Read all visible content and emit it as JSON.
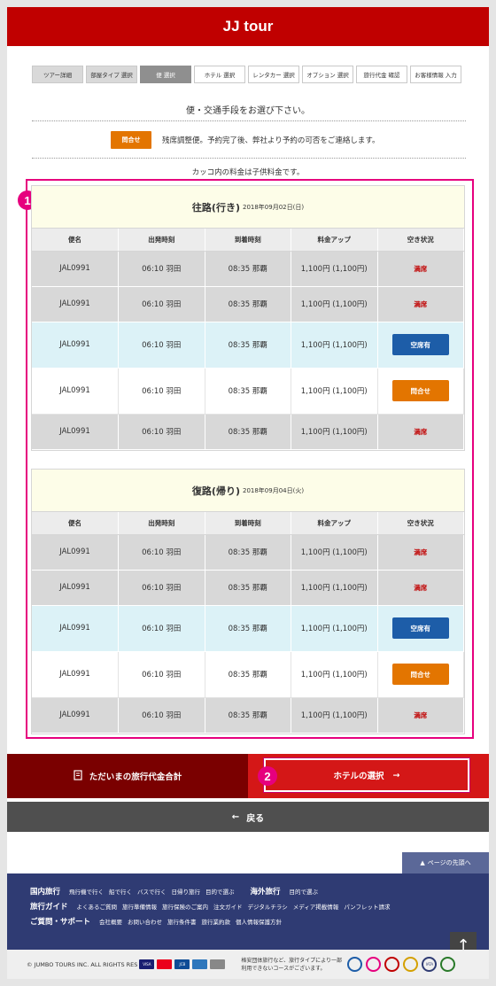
{
  "header": {
    "title": "JJ tour"
  },
  "steps": [
    {
      "label": "ツアー詳細",
      "state": "done"
    },
    {
      "label": "部屋タイプ 選択",
      "state": "done"
    },
    {
      "label": "便 選択",
      "state": "active"
    },
    {
      "label": "ホテル 選択",
      "state": "todo"
    },
    {
      "label": "レンタカー 選択",
      "state": "todo"
    },
    {
      "label": "オプション 選択",
      "state": "todo"
    },
    {
      "label": "旅行代金 確認",
      "state": "todo"
    },
    {
      "label": "お客様情報 入力",
      "state": "todo"
    }
  ],
  "lead": "便・交通手段をお選び下さい。",
  "notice": {
    "button": "問合せ",
    "text": "残席調整便。予約完了後、弊社より予約の可否をご連絡します。"
  },
  "child_note": "カッコ内の料金は子供料金です。",
  "badges": {
    "one": "1",
    "two": "2"
  },
  "columns": [
    "便名",
    "出発時刻",
    "到着時刻",
    "料金アップ",
    "空き状況"
  ],
  "outbound": {
    "direction": "往路(行き)",
    "date": "2018年09月02日(日)",
    "rows": [
      {
        "flight": "JAL0991",
        "dep": "06:10 羽田",
        "arr": "08:35 那覇",
        "price": "1,100円 (1,100円)",
        "status": "満席"
      },
      {
        "flight": "JAL0991",
        "dep": "06:10 羽田",
        "arr": "08:35 那覇",
        "price": "1,100円 (1,100円)",
        "status": "満席"
      },
      {
        "flight": "JAL0991",
        "dep": "06:10 羽田",
        "arr": "08:35 那覇",
        "price": "1,100円 (1,100円)",
        "status": "空席有"
      },
      {
        "flight": "JAL0991",
        "dep": "06:10 羽田",
        "arr": "08:35 那覇",
        "price": "1,100円 (1,100円)",
        "status": "問合せ"
      },
      {
        "flight": "JAL0991",
        "dep": "06:10 羽田",
        "arr": "08:35 那覇",
        "price": "1,100円 (1,100円)",
        "status": "満席"
      }
    ]
  },
  "inbound": {
    "direction": "復路(帰り)",
    "date": "2018年09月04日(火)",
    "rows": [
      {
        "flight": "JAL0991",
        "dep": "06:10 羽田",
        "arr": "08:35 那覇",
        "price": "1,100円 (1,100円)",
        "status": "満席"
      },
      {
        "flight": "JAL0991",
        "dep": "06:10 羽田",
        "arr": "08:35 那覇",
        "price": "1,100円 (1,100円)",
        "status": "満席"
      },
      {
        "flight": "JAL0991",
        "dep": "06:10 羽田",
        "arr": "08:35 那覇",
        "price": "1,100円 (1,100円)",
        "status": "空席有"
      },
      {
        "flight": "JAL0991",
        "dep": "06:10 羽田",
        "arr": "08:35 那覇",
        "price": "1,100円 (1,100円)",
        "status": "問合せ"
      },
      {
        "flight": "JAL0991",
        "dep": "06:10 羽田",
        "arr": "08:35 那覇",
        "price": "1,100円 (1,100円)",
        "status": "満席"
      }
    ]
  },
  "actions": {
    "total": "ただいまの旅行代金合計",
    "hotel": "ホテルの選択",
    "back": "戻る",
    "pagetop": "ページの先頭へ"
  },
  "footer": {
    "rows": [
      {
        "head": "国内旅行",
        "links": [
          "飛行機で行く",
          "船で行く",
          "バスで行く",
          "日帰り旅行",
          "目的で選ぶ"
        ],
        "head2": "海外旅行",
        "links2": [
          "目的で選ぶ"
        ]
      },
      {
        "head": "旅行ガイド",
        "links": [
          "よくあるご質問",
          "旅行準備情報",
          "旅行保険のご案内",
          "注文ガイド",
          "デジタルチラシ",
          "メディア掲載情報",
          "パンフレット請求"
        ]
      },
      {
        "head": "ご質問・サポート",
        "links": [
          "会社概要",
          "お問い合わせ",
          "旅行条件書",
          "旅行業約款",
          "個人情報保護方針"
        ]
      }
    ],
    "copyright": "© JUMBO TOURS INC. ALL RIGHTS RES",
    "card_brands": [
      "VISA",
      "",
      "JCB",
      "",
      ""
    ],
    "note": "格安団体旅行など、旅行タイプにより一部利用できないコースがございます。",
    "logo_texts": [
      "",
      "",
      "",
      "",
      "IATA",
      ""
    ]
  },
  "colors": {
    "brand_red": "#c00000",
    "highlight": "#e6007e",
    "available_blue": "#1d5da8",
    "inquiry_orange": "#e37500",
    "footer_navy": "#2f3b73"
  }
}
